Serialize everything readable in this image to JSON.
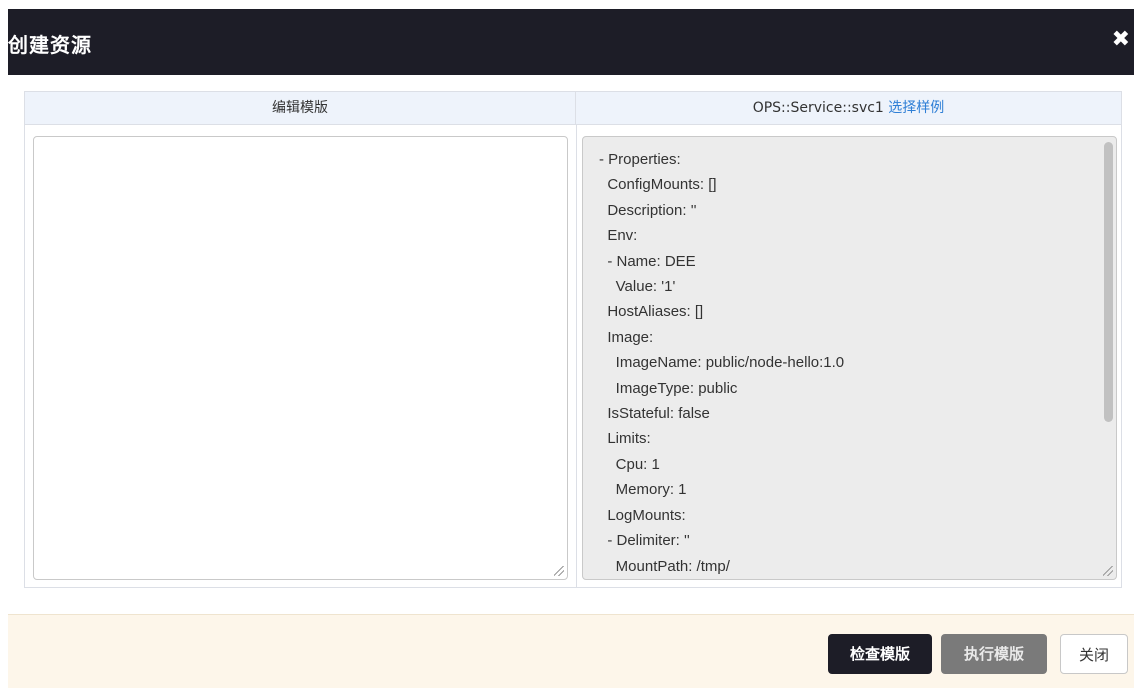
{
  "dialog": {
    "title": "创建资源",
    "close_icon": "close-icon"
  },
  "table": {
    "left_header": "编辑模版",
    "right_header_prefix": "OPS::Service::svc1 ",
    "right_header_link": "选择样例",
    "editor_value": ""
  },
  "sample": {
    "lines": [
      "- Properties:",
      "  ConfigMounts: []",
      "  Description: ''",
      "  Env:",
      "  - Name: DEE",
      "    Value: '1'",
      "  HostAliases: []",
      "  Image:",
      "    ImageName: public/node-hello:1.0",
      "    ImageType: public",
      "  IsStateful: false",
      "  Limits:",
      "    Cpu: 1",
      "    Memory: 1",
      "  LogMounts:",
      "  - Delimiter: ''",
      "    MountPath: /tmp/"
    ]
  },
  "footer": {
    "check_label": "检查模版",
    "run_label": "执行模版",
    "close_label": "关闭"
  },
  "colors": {
    "header_bg": "#1d1d27",
    "link": "#2f7fd6",
    "footer_bg": "#fdf6ea",
    "run_disabled": "#7a7a7a"
  }
}
